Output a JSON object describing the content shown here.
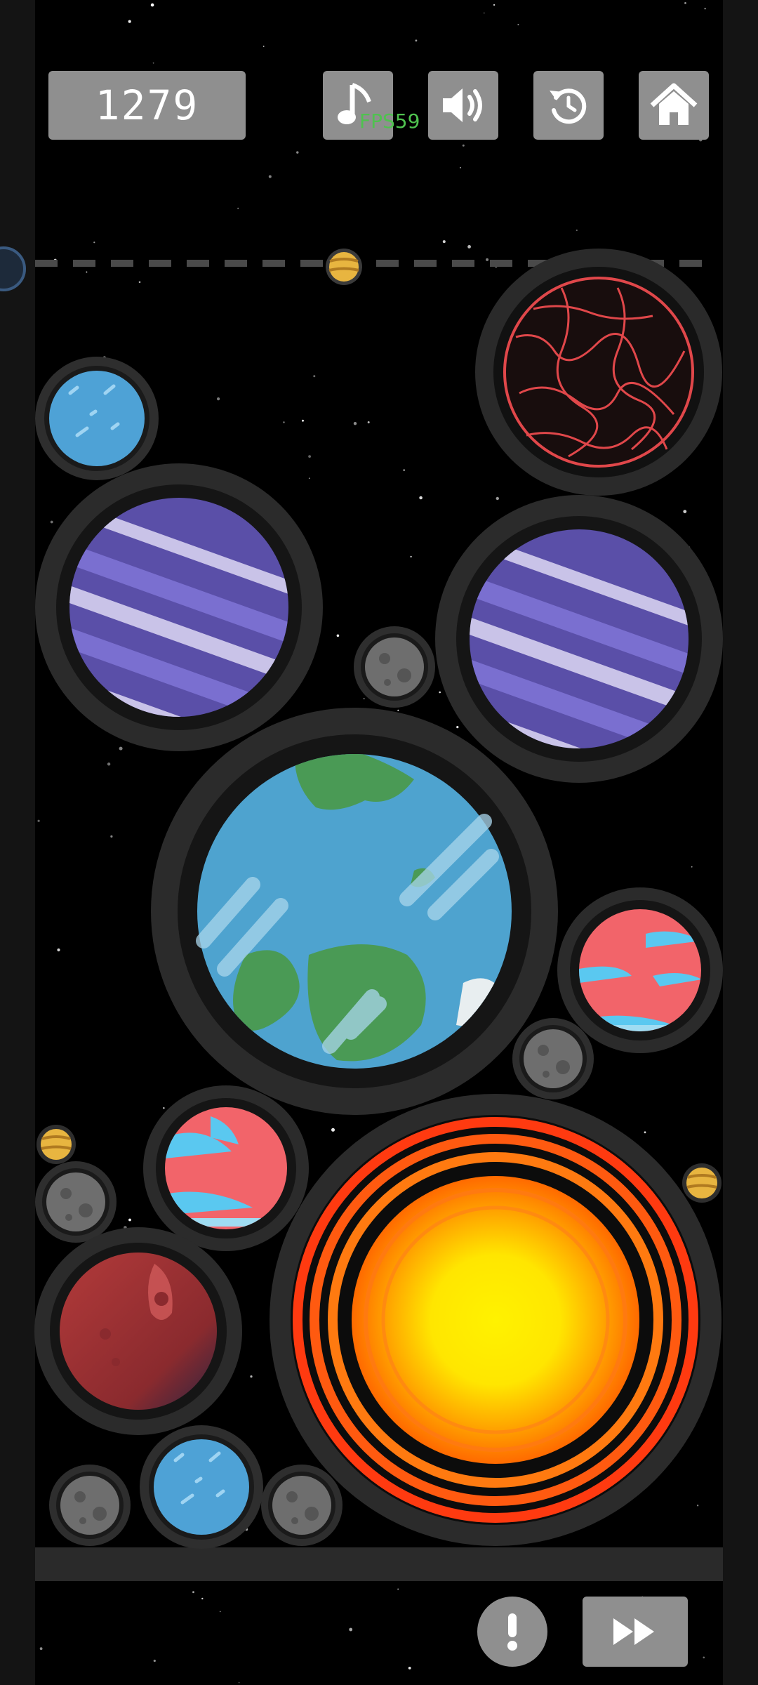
{
  "hud": {
    "score": "1279",
    "fps": "FPS59"
  },
  "buttons": {
    "music": "music-note-icon",
    "sound": "speaker-icon",
    "restart": "restart-icon",
    "home": "home-icon",
    "alert": "exclamation-icon",
    "fast_forward": "fast-forward-icon"
  },
  "colors": {
    "space": "#000000",
    "frame": "#141414",
    "ring": "#2b2b2b",
    "ring_outer": "#3c3c3c",
    "button": "#8f8f8f",
    "fps_text": "#4fc24f"
  },
  "planets": [
    {
      "name": "planet-jupiter-small",
      "type": "jupiter"
    },
    {
      "name": "planet-lava",
      "type": "lava"
    },
    {
      "name": "planet-ice-small",
      "type": "ice"
    },
    {
      "name": "planet-neptune-left",
      "type": "neptune"
    },
    {
      "name": "planet-neptune-right",
      "type": "neptune"
    },
    {
      "name": "planet-moon",
      "type": "moon"
    },
    {
      "name": "planet-earth",
      "type": "earth"
    },
    {
      "name": "planet-pink",
      "type": "pink"
    },
    {
      "name": "planet-moon",
      "type": "moon"
    },
    {
      "name": "planet-jupiter-small",
      "type": "jupiter"
    },
    {
      "name": "planet-moon",
      "type": "moon"
    },
    {
      "name": "planet-pink",
      "type": "pink"
    },
    {
      "name": "planet-sun",
      "type": "sun"
    },
    {
      "name": "planet-jupiter-small",
      "type": "jupiter"
    },
    {
      "name": "planet-mars",
      "type": "mars"
    },
    {
      "name": "planet-moon",
      "type": "moon"
    },
    {
      "name": "planet-ice-small",
      "type": "ice"
    },
    {
      "name": "planet-moon",
      "type": "moon"
    }
  ]
}
